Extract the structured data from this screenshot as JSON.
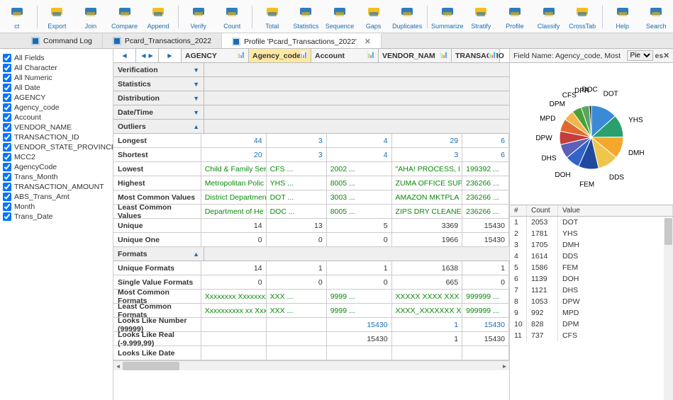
{
  "toolbar": [
    {
      "name": "contact",
      "label": "ct",
      "color": "#1a6db3"
    },
    {
      "name": "export",
      "label": "Export",
      "color": "#f2b705"
    },
    {
      "name": "join",
      "label": "Join",
      "color": "#1a6db3"
    },
    {
      "name": "compare",
      "label": "Compare",
      "color": "#1a6db3"
    },
    {
      "name": "append",
      "label": "Append",
      "color": "#1a6db3"
    },
    {
      "name": "verify",
      "label": "Verify",
      "color": "#1a6db3"
    },
    {
      "name": "count",
      "label": "Count",
      "color": "#1a6db3"
    },
    {
      "name": "total",
      "label": "Total",
      "color": "#1a6db3"
    },
    {
      "name": "statistics",
      "label": "Statistics",
      "color": "#1a6db3"
    },
    {
      "name": "sequence",
      "label": "Sequence",
      "color": "#1a6db3"
    },
    {
      "name": "gaps",
      "label": "Gaps",
      "color": "#1a6db3"
    },
    {
      "name": "duplicates",
      "label": "Duplicates",
      "color": "#1a6db3"
    },
    {
      "name": "summarize",
      "label": "Summarize",
      "color": "#f2b705"
    },
    {
      "name": "stratify",
      "label": "Stratify",
      "color": "#1a6db3"
    },
    {
      "name": "profile",
      "label": "Profile",
      "color": "#f2b705"
    },
    {
      "name": "classify",
      "label": "Classify",
      "color": "#1a6db3"
    },
    {
      "name": "crosstab",
      "label": "CrossTab",
      "color": "#1a6db3"
    },
    {
      "name": "help",
      "label": "Help",
      "color": "#1a6db3"
    },
    {
      "name": "search",
      "label": "Search",
      "color": "#1a6db3"
    }
  ],
  "tabs": [
    {
      "name": "command-log",
      "label": "Command Log"
    },
    {
      "name": "pcard-transactions",
      "label": "Pcard_Transactions_2022"
    },
    {
      "name": "profile-pcard",
      "label": "Profile 'Pcard_Transactions_2022'",
      "active": true,
      "closable": true
    }
  ],
  "fields": [
    "All Fields",
    "All Character",
    "All Numeric",
    "All Date",
    "AGENCY",
    "Agency_code",
    "Account",
    "VENDOR_NAME",
    "TRANSACTION_ID",
    "VENDOR_STATE_PROVINCE",
    "MCC2",
    "AgencyCode",
    "Trans_Month",
    "TRANSACTION_AMOUNT",
    "ABS_Trans_Amt",
    "Month",
    "Trans_Date"
  ],
  "columns": [
    "AGENCY",
    "Agency_code",
    "Account",
    "VENDOR_NAM",
    "TRANSACTIO"
  ],
  "selectedColumn": 1,
  "sections": [
    {
      "label": "Verification",
      "open": false
    },
    {
      "label": "Statistics",
      "open": false
    },
    {
      "label": "Distribution",
      "open": false
    },
    {
      "label": "Date/Time",
      "open": false
    },
    {
      "label": "Outliers",
      "open": true
    }
  ],
  "outliers": {
    "Longest": {
      "cells": [
        "44",
        "3",
        "4",
        "29",
        "6"
      ],
      "cls": "blue"
    },
    "Shortest": {
      "cells": [
        "20",
        "3",
        "4",
        "3",
        "6"
      ],
      "cls": "blue"
    },
    "Lowest": {
      "cells": [
        "Child & Family Ser",
        "CFS  ...",
        "2002  ...",
        "\"AHA! PROCESS, I",
        "199392  ..."
      ],
      "cls": "green"
    },
    "Highest": {
      "cells": [
        "Metropolitan Polic",
        "YHS  ...",
        "8005  ...",
        "ZUMA OFFICE SUP",
        "236266  ..."
      ],
      "cls": "green"
    },
    "Most Common Values": {
      "cells": [
        "District Departmen",
        "DOT  ...",
        "3003  ...",
        "AMAZON MKTPLA",
        "236266  ..."
      ],
      "cls": "green"
    },
    "Least Common Values": {
      "cells": [
        "Department of He",
        "DOC  ...",
        "8005  ...",
        "ZIPS DRY CLEANER",
        "236266  ..."
      ],
      "cls": "green"
    },
    "Unique": {
      "cells": [
        "14",
        "13",
        "5",
        "3369",
        "15430"
      ],
      "cls": ""
    },
    "Unique One": {
      "cells": [
        "0",
        "0",
        "0",
        "1966",
        "15430"
      ],
      "cls": ""
    }
  },
  "formats": {
    "Unique Formats": {
      "cells": [
        "14",
        "1",
        "1",
        "1638",
        "1"
      ],
      "cls": ""
    },
    "Single Value Formats": {
      "cells": [
        "0",
        "0",
        "0",
        "665",
        "0"
      ],
      "cls": ""
    },
    "Most Common Formats": {
      "cells": [
        "Xxxxxxxx Xxxxxxxxxx",
        "XXX  ...",
        "9999  ...",
        "XXXXX XXXX XXX",
        "999999  ..."
      ],
      "cls": "green"
    },
    "Least Common Formats": {
      "cells": [
        "Xxxxxxxxxx xx Xxxx",
        "XXX  ...",
        "9999  ...",
        "XXXX_XXXXXXX X",
        "999999  ..."
      ],
      "cls": "green"
    },
    "Looks Like Number (99999)": {
      "cells": [
        "",
        "",
        "15430",
        "1",
        "15430"
      ],
      "cls": "blue"
    },
    "Looks Like Real (-9.999,99)": {
      "cells": [
        "",
        "",
        "15430",
        "1",
        "15430"
      ],
      "cls": ""
    },
    "Looks Like Date": {
      "cells": [
        "",
        "",
        "",
        "",
        ""
      ],
      "cls": ""
    }
  },
  "fieldNameHeader": "Field Name: Agency_code, Most",
  "chartTypeOptions": [
    "Pie"
  ],
  "chartTypeSelected": "Pie",
  "chart_data": {
    "type": "pie",
    "title": "",
    "series": [
      {
        "name": "DOT",
        "value": 2053,
        "color": "#3a8ad6"
      },
      {
        "name": "YHS",
        "value": 1781,
        "color": "#2aa06e"
      },
      {
        "name": "DMH",
        "value": 1705,
        "color": "#f4a72a"
      },
      {
        "name": "DDS",
        "value": 1614,
        "color": "#eec64c"
      },
      {
        "name": "FEM",
        "value": 1586,
        "color": "#1f4aa0"
      },
      {
        "name": "DOH",
        "value": 1139,
        "color": "#3163c9"
      },
      {
        "name": "DHS",
        "value": 1121,
        "color": "#5b60b8"
      },
      {
        "name": "DPW",
        "value": 1053,
        "color": "#c43c3c"
      },
      {
        "name": "MPD",
        "value": 992,
        "color": "#e06730"
      },
      {
        "name": "DPM",
        "value": 828,
        "color": "#f2b64c"
      },
      {
        "name": "CFS",
        "value": 737,
        "color": "#48a036"
      },
      {
        "name": "DPR",
        "value": 650,
        "color": "#5aa562"
      },
      {
        "name": "DOC",
        "value": 171,
        "color": "#222222"
      }
    ]
  },
  "countTable": {
    "headers": [
      "#",
      "Count",
      "Value"
    ],
    "rows": [
      [
        "1",
        "2053",
        "DOT"
      ],
      [
        "2",
        "1781",
        "YHS"
      ],
      [
        "3",
        "1705",
        "DMH"
      ],
      [
        "4",
        "1614",
        "DDS"
      ],
      [
        "5",
        "1586",
        "FEM"
      ],
      [
        "6",
        "1139",
        "DOH"
      ],
      [
        "7",
        "1121",
        "DHS"
      ],
      [
        "8",
        "1053",
        "DPW"
      ],
      [
        "9",
        "992",
        "MPD"
      ],
      [
        "10",
        "828",
        "DPM"
      ],
      [
        "11",
        "737",
        "CFS"
      ]
    ]
  }
}
